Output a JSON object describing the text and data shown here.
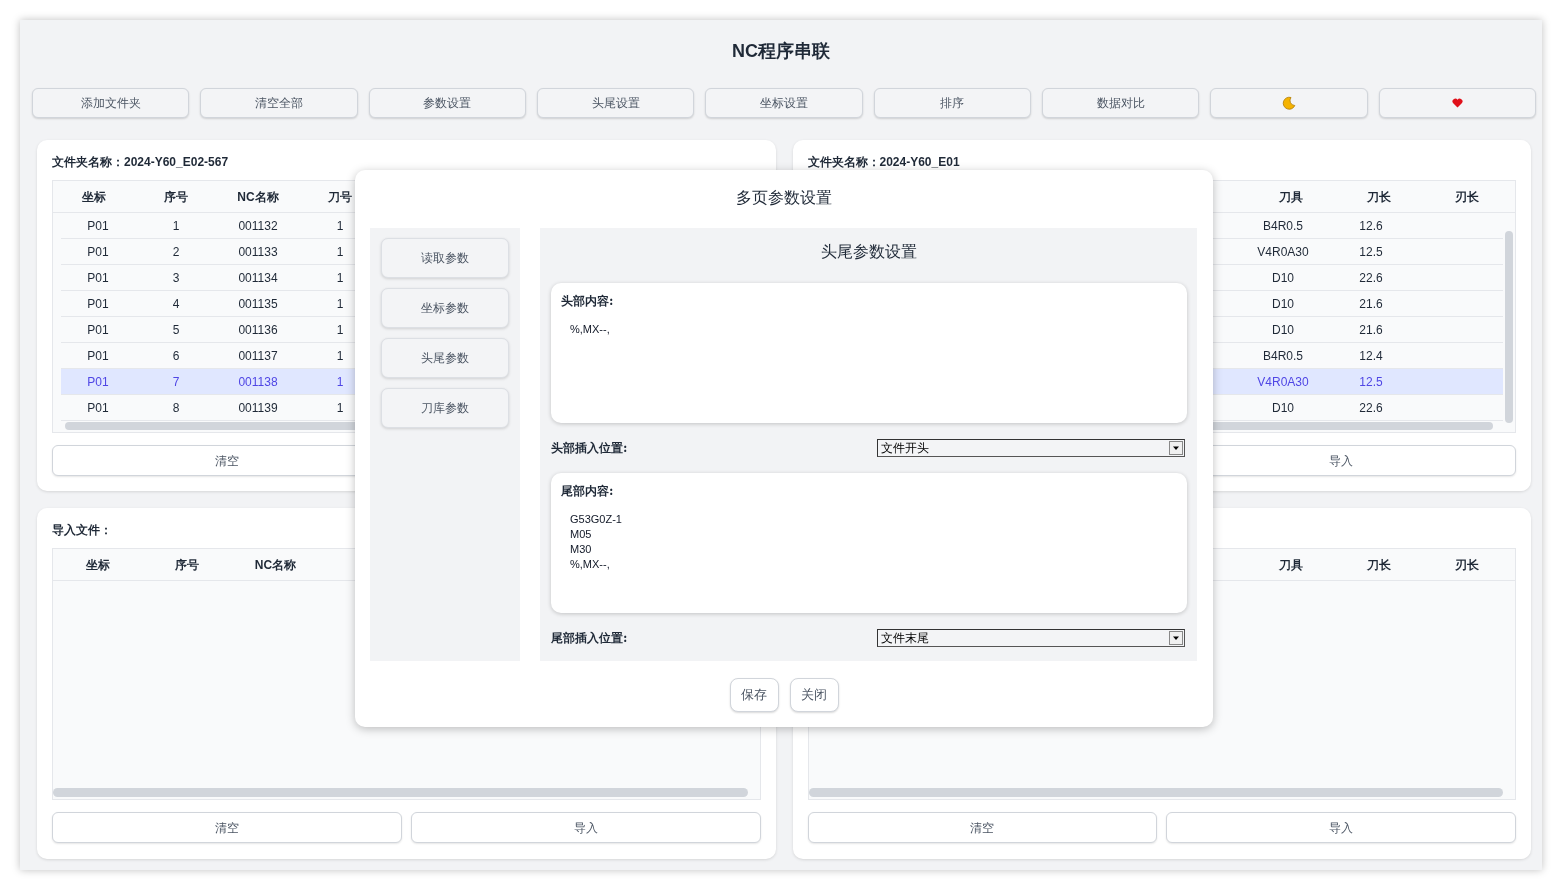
{
  "title": "NC程序串联",
  "toolbar": [
    "添加文件夹",
    "清空全部",
    "参数设置",
    "头尾设置",
    "坐标设置",
    "排序",
    "数据对比"
  ],
  "panels": [
    {
      "heading": "文件夹名称：2024-Y60_E02-567",
      "columns": [
        "坐标",
        "序号",
        "NC名称",
        "刀号"
      ],
      "rows": [
        {
          "cells": [
            "P01",
            "1",
            "001132",
            "1"
          ],
          "selected": false
        },
        {
          "cells": [
            "P01",
            "2",
            "001133",
            "1"
          ],
          "selected": false
        },
        {
          "cells": [
            "P01",
            "3",
            "001134",
            "1"
          ],
          "selected": false
        },
        {
          "cells": [
            "P01",
            "4",
            "001135",
            "1"
          ],
          "selected": false
        },
        {
          "cells": [
            "P01",
            "5",
            "001136",
            "1"
          ],
          "selected": false
        },
        {
          "cells": [
            "P01",
            "6",
            "001137",
            "1"
          ],
          "selected": false
        },
        {
          "cells": [
            "P01",
            "7",
            "001138",
            "1"
          ],
          "selected": true
        },
        {
          "cells": [
            "P01",
            "8",
            "001139",
            "1"
          ],
          "selected": false
        }
      ],
      "buttons": [
        "清空"
      ]
    },
    {
      "heading": "文件夹名称：2024-Y60_E01",
      "columns": [
        "刀具",
        "刀长",
        "刃长"
      ],
      "rows": [
        {
          "cells": [
            "B4R0.5",
            "12.6",
            ""
          ],
          "selected": false
        },
        {
          "cells": [
            "V4R0A30",
            "12.5",
            ""
          ],
          "selected": false
        },
        {
          "cells": [
            "D10",
            "22.6",
            ""
          ],
          "selected": false
        },
        {
          "cells": [
            "D10",
            "21.6",
            ""
          ],
          "selected": false
        },
        {
          "cells": [
            "D10",
            "21.6",
            ""
          ],
          "selected": false
        },
        {
          "cells": [
            "B4R0.5",
            "12.4",
            ""
          ],
          "selected": false
        },
        {
          "cells": [
            "V4R0A30",
            "12.5",
            ""
          ],
          "selected": true
        },
        {
          "cells": [
            "D10",
            "22.6",
            ""
          ],
          "selected": false
        }
      ],
      "buttons": [
        "导入"
      ]
    },
    {
      "heading": "导入文件：",
      "columns": [
        "坐标",
        "序号",
        "NC名称"
      ],
      "buttons": [
        "清空",
        "导入"
      ]
    },
    {
      "columns": [
        "刀具",
        "刀长",
        "刃长"
      ],
      "buttons": [
        "清空",
        "导入"
      ]
    }
  ],
  "dialog": {
    "title": "多页参数设置",
    "nav": [
      "读取参数",
      "坐标参数",
      "头尾参数",
      "刀库参数"
    ],
    "page_title": "头尾参数设置",
    "head": {
      "label": "头部内容:",
      "content": "%,MX--,"
    },
    "head_position": {
      "label": "头部插入位置:",
      "value": "文件开头"
    },
    "tail": {
      "label": "尾部内容:",
      "content": "G53G0Z-1\nM05\nM30\n%,MX--,"
    },
    "tail_position": {
      "label": "尾部插入位置:",
      "value": "文件末尾"
    },
    "buttons": [
      "保存",
      "关闭"
    ]
  }
}
